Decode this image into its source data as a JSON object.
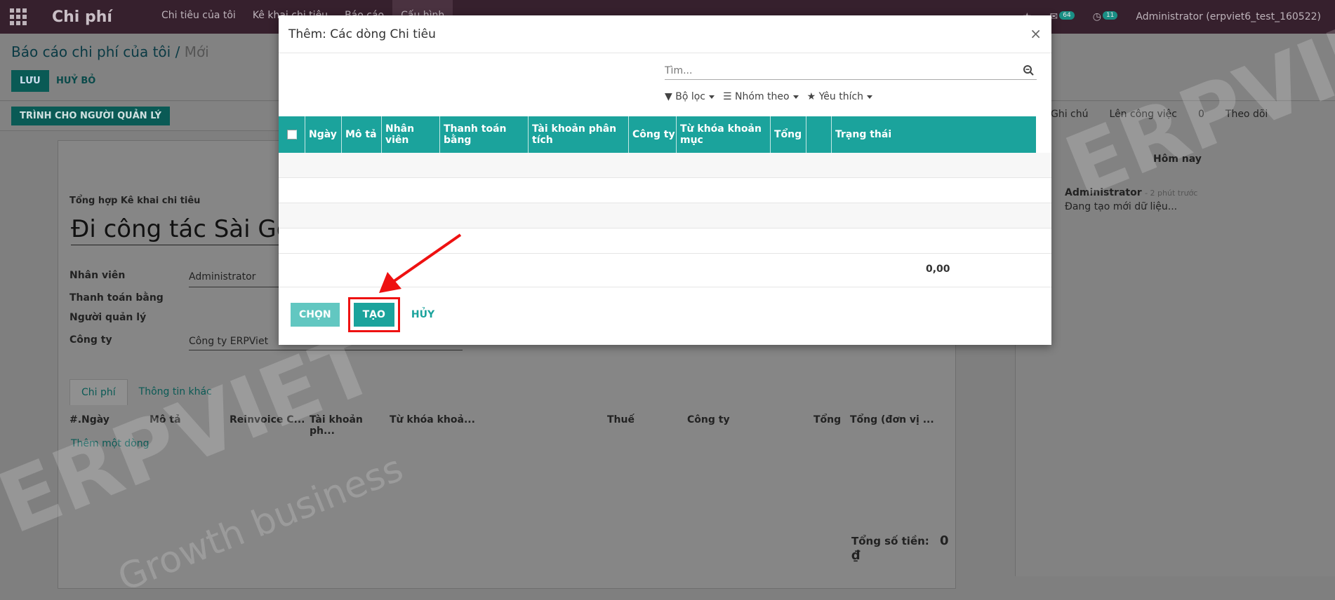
{
  "navbar": {
    "brand": "Chi phí",
    "menu": [
      "Chi tiêu của tôi",
      "Kê khai chi tiêu",
      "Báo cáo",
      "Cấu hình"
    ],
    "badges": [
      "64",
      "11"
    ],
    "user": "Administrator (erpviet6_test_160522)"
  },
  "control": {
    "breadcrumb_parent": "Báo cáo chi phí của tôi",
    "breadcrumb_sep": "/",
    "breadcrumb_current": "Mới",
    "save": "LƯU",
    "discard": "HUỶ BỎ",
    "submit": "TRÌNH CHO NGƯỜI QUẢN LÝ"
  },
  "form": {
    "summary_label": "Tổng hợp Kê khai chi tiêu",
    "title": "Đi công tác Sài Gòn",
    "employee_label": "Nhân viên",
    "employee_value": "Administrator",
    "payment_label": "Thanh toán bằng",
    "manager_label": "Người quản lý",
    "company_label": "Công ty",
    "company_value": "Công ty ERPViet",
    "tabs": [
      "Chi phí",
      "Thông tin khác"
    ],
    "columns": [
      "#.Ngày",
      "Mô tả",
      "Reinvoice C...",
      "Tài khoản ph...",
      "Từ khóa khoả...",
      "Thuế",
      "Công ty",
      "Tổng",
      "Tổng (đơn vị ..."
    ],
    "add_line": "Thêm một dòng",
    "total_label": "Tổng số tiền:",
    "total_value": "0 ₫"
  },
  "chatter": {
    "actions": [
      "Ghi chú",
      "Lên công việc",
      "0",
      "Theo dõi"
    ],
    "today": "Hôm nay",
    "author": "Administrator",
    "time": "- 2 phút trước",
    "message": "Đang tạo mới dữ liệu..."
  },
  "watermark": {
    "brand": "ERPVIET",
    "tagline": "Growth business"
  },
  "modal": {
    "title": "Thêm: Các dòng Chi tiêu",
    "close": "×",
    "search_placeholder": "Tìm...",
    "filters": [
      "Bộ lọc",
      "Nhóm theo",
      "Yêu thích"
    ],
    "columns": [
      "Ngày",
      "Mô tả",
      "Nhân viên",
      "Thanh toán bằng",
      "Tài khoản phân tích",
      "Công ty",
      "Từ khóa khoản mục",
      "Tổng",
      "",
      "Trạng thái"
    ],
    "total": "0,00",
    "btn_choose": "CHỌN",
    "btn_create": "TẠO",
    "btn_cancel": "HỦY"
  },
  "colors": {
    "accent": "#1ba39c",
    "annotation": "#ee1111"
  }
}
